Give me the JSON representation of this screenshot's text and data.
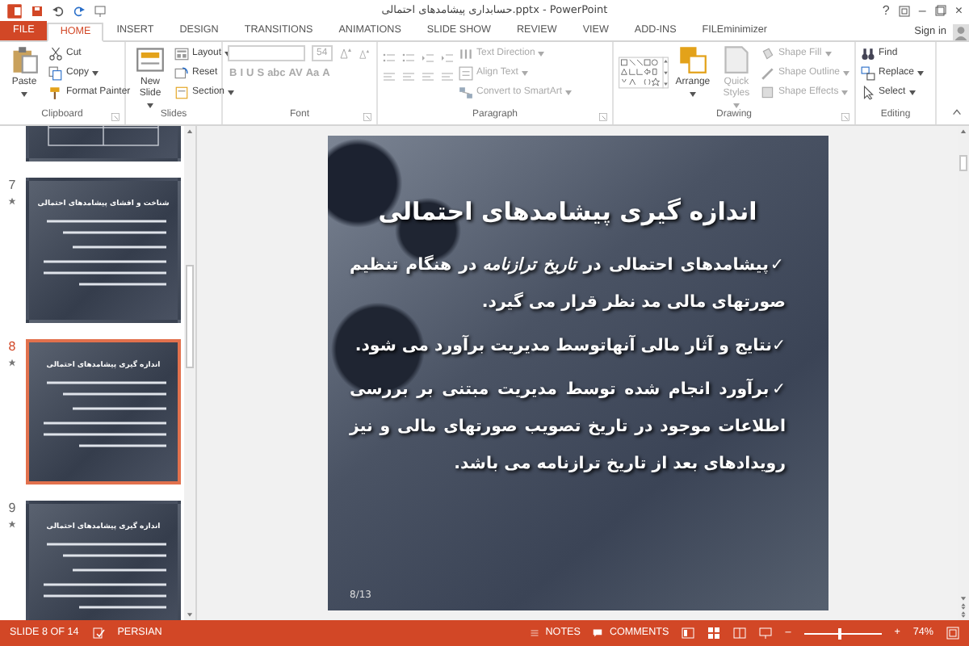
{
  "title_bar": {
    "title": "حسابداری پیشامدهای احتمالی.pptx - PowerPoint",
    "help": "?",
    "minimize": "–",
    "close": "×"
  },
  "tabs": [
    {
      "label": "FILE",
      "kind": "file",
      "selected": false
    },
    {
      "label": "HOME",
      "kind": "tab",
      "selected": true
    },
    {
      "label": "INSERT",
      "kind": "tab",
      "selected": false
    },
    {
      "label": "DESIGN",
      "kind": "tab",
      "selected": false
    },
    {
      "label": "TRANSITIONS",
      "kind": "tab",
      "selected": false
    },
    {
      "label": "ANIMATIONS",
      "kind": "tab",
      "selected": false
    },
    {
      "label": "SLIDE SHOW",
      "kind": "tab",
      "selected": false
    },
    {
      "label": "REVIEW",
      "kind": "tab",
      "selected": false
    },
    {
      "label": "VIEW",
      "kind": "tab",
      "selected": false
    },
    {
      "label": "ADD-INS",
      "kind": "tab",
      "selected": false
    },
    {
      "label": "FILEminimizer",
      "kind": "tab",
      "selected": false
    }
  ],
  "sign_in": "Sign in",
  "ribbon": [
    {
      "label": "Clipboard",
      "kind": "standard",
      "launcher": true,
      "items": [
        {
          "kind": "large",
          "label": "Paste",
          "dropdown": true,
          "disabled": false
        },
        {
          "kind": "small",
          "label": "Cut",
          "dropdown": false,
          "disabled": false
        },
        {
          "kind": "small",
          "label": "Copy",
          "dropdown": true,
          "disabled": false
        },
        {
          "kind": "small",
          "label": "Format Painter",
          "dropdown": false,
          "disabled": false
        }
      ]
    },
    {
      "label": "Slides",
      "kind": "standard",
      "launcher": false,
      "items": [
        {
          "kind": "large",
          "label": "New Slide",
          "dropdown": true,
          "disabled": false
        },
        {
          "kind": "small",
          "label": "Layout",
          "dropdown": true,
          "disabled": false
        },
        {
          "kind": "small",
          "label": "Reset",
          "dropdown": false,
          "disabled": false
        },
        {
          "kind": "small",
          "label": "Section",
          "dropdown": true,
          "disabled": false
        }
      ]
    },
    {
      "label": "Font",
      "kind": "font",
      "launcher": true,
      "size": "54",
      "buttons": [
        "B",
        "I",
        "U",
        "S",
        "abc",
        "AV",
        "Aa",
        "A"
      ]
    },
    {
      "label": "Paragraph",
      "kind": "paragraph",
      "launcher": true,
      "items": [
        {
          "kind": "small",
          "label": "Text Direction",
          "dropdown": true,
          "disabled": true
        },
        {
          "kind": "small",
          "label": "Align Text",
          "dropdown": true,
          "disabled": true
        },
        {
          "kind": "small",
          "label": "Convert to SmartArt",
          "dropdown": true,
          "disabled": true
        }
      ]
    },
    {
      "label": "Drawing",
      "kind": "drawing",
      "launcher": true,
      "items": [
        {
          "kind": "large",
          "label": "Arrange",
          "dropdown": true,
          "disabled": false
        },
        {
          "kind": "large",
          "label": "Quick Styles",
          "dropdown": true,
          "disabled": true
        },
        {
          "kind": "small",
          "label": "Shape Fill",
          "dropdown": true,
          "disabled": true
        },
        {
          "kind": "small",
          "label": "Shape Outline",
          "dropdown": true,
          "disabled": true
        },
        {
          "kind": "small",
          "label": "Shape Effects",
          "dropdown": true,
          "disabled": true
        }
      ]
    },
    {
      "label": "Editing",
      "kind": "standard",
      "launcher": false,
      "items": [
        {
          "kind": "small",
          "label": "Find",
          "dropdown": false,
          "disabled": false
        },
        {
          "kind": "small",
          "label": "Replace",
          "dropdown": true,
          "disabled": false
        },
        {
          "kind": "small",
          "label": "Select",
          "dropdown": true,
          "disabled": false
        }
      ]
    }
  ],
  "thumbnails": [
    {
      "kind": "cut_top",
      "selected": false
    },
    {
      "kind": "full",
      "number": "7",
      "title": "شناخت و افشای پیشامدهای احتمالی",
      "selected": false
    },
    {
      "kind": "full",
      "number": "8",
      "title": "اندازه گیری پیشامدهای احتمالی",
      "selected": true
    },
    {
      "kind": "full",
      "number": "9",
      "title": "اندازه گیری پیشامدهای احتمالی",
      "selected": false
    }
  ],
  "slide": {
    "title": "اندازه گیری پیشامدهای احتمالی",
    "bullets": [
      {
        "marker": "✓",
        "text": "پیشامدهای احتمالی در *تاریخ ترازنامه* در هنگام تنظیم صورتهای مالی مد نظر قرار می گیرد."
      },
      {
        "marker": "✓",
        "text": "نتایج و آثار مالی آنهاتوسط مدیریت برآورد می شود."
      },
      {
        "marker": "✓",
        "text": "برآورد انجام شده توسط مدیریت مبتنی بر بررسی اطلاعات موجود در تاریخ تصویب صورتهای مالی و نیز رویدادهای بعد از تاریخ ترازنامه می باشد."
      }
    ],
    "page_number": "8/13"
  },
  "status_bar": {
    "slide": "SLIDE 8 OF 14",
    "language": "PERSIAN",
    "notes": "NOTES",
    "comments": "COMMENTS",
    "zoom_out": "–",
    "zoom_in": "+",
    "zoom": {
      "level": 0.45
    },
    "zoom_value": "74%"
  }
}
